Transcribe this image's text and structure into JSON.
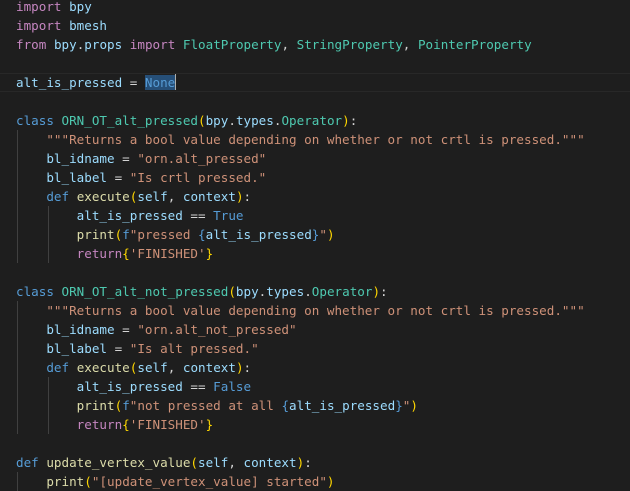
{
  "editor": {
    "language": "python",
    "selection": "None",
    "lines": [
      [
        [
          "ctl",
          "import"
        ],
        [
          "op",
          " "
        ],
        [
          "var",
          "bpy"
        ]
      ],
      [
        [
          "ctl",
          "import"
        ],
        [
          "op",
          " "
        ],
        [
          "var",
          "bmesh"
        ]
      ],
      [
        [
          "ctl",
          "from"
        ],
        [
          "op",
          " "
        ],
        [
          "var",
          "bpy"
        ],
        [
          "op",
          "."
        ],
        [
          "var",
          "props"
        ],
        [
          "op",
          " "
        ],
        [
          "ctl",
          "import"
        ],
        [
          "op",
          " "
        ],
        [
          "cls",
          "FloatProperty"
        ],
        [
          "op",
          ", "
        ],
        [
          "cls",
          "StringProperty"
        ],
        [
          "op",
          ", "
        ],
        [
          "cls",
          "PointerProperty"
        ]
      ],
      [],
      [
        [
          "var",
          "alt_is_pressed"
        ],
        [
          "op",
          " = "
        ],
        [
          "sel",
          "None"
        ]
      ],
      [],
      [
        [
          "kw",
          "class"
        ],
        [
          "op",
          " "
        ],
        [
          "cls",
          "ORN_OT_alt_pressed"
        ],
        [
          "p1",
          "("
        ],
        [
          "var",
          "bpy"
        ],
        [
          "op",
          "."
        ],
        [
          "var",
          "types"
        ],
        [
          "op",
          "."
        ],
        [
          "cls",
          "Operator"
        ],
        [
          "p1",
          ")"
        ],
        [
          "op",
          ":"
        ]
      ],
      [
        [
          "op",
          "    "
        ],
        [
          "str",
          "\"\"\"Returns a bool value depending on whether or not crtl is pressed.\"\"\""
        ]
      ],
      [
        [
          "op",
          "    "
        ],
        [
          "var",
          "bl_idname"
        ],
        [
          "op",
          " = "
        ],
        [
          "str",
          "\"orn.alt_pressed\""
        ]
      ],
      [
        [
          "op",
          "    "
        ],
        [
          "var",
          "bl_label"
        ],
        [
          "op",
          " = "
        ],
        [
          "str",
          "\"Is crtl pressed.\""
        ]
      ],
      [
        [
          "op",
          "    "
        ],
        [
          "kw",
          "def"
        ],
        [
          "op",
          " "
        ],
        [
          "fn",
          "execute"
        ],
        [
          "p1",
          "("
        ],
        [
          "var",
          "self"
        ],
        [
          "op",
          ", "
        ],
        [
          "var",
          "context"
        ],
        [
          "p1",
          ")"
        ],
        [
          "op",
          ":"
        ]
      ],
      [
        [
          "op",
          "        "
        ],
        [
          "var",
          "alt_is_pressed"
        ],
        [
          "op",
          " == "
        ],
        [
          "kw",
          "True"
        ]
      ],
      [
        [
          "op",
          "        "
        ],
        [
          "fn",
          "print"
        ],
        [
          "p1",
          "("
        ],
        [
          "kw",
          "f"
        ],
        [
          "str",
          "\"pressed "
        ],
        [
          "kw",
          "{"
        ],
        [
          "var",
          "alt_is_pressed"
        ],
        [
          "kw",
          "}"
        ],
        [
          "str",
          "\""
        ],
        [
          "p1",
          ")"
        ]
      ],
      [
        [
          "op",
          "        "
        ],
        [
          "ctl",
          "return"
        ],
        [
          "p1",
          "{"
        ],
        [
          "str",
          "'FINISHED'"
        ],
        [
          "p1",
          "}"
        ]
      ],
      [],
      [
        [
          "kw",
          "class"
        ],
        [
          "op",
          " "
        ],
        [
          "cls",
          "ORN_OT_alt_not_pressed"
        ],
        [
          "p1",
          "("
        ],
        [
          "var",
          "bpy"
        ],
        [
          "op",
          "."
        ],
        [
          "var",
          "types"
        ],
        [
          "op",
          "."
        ],
        [
          "cls",
          "Operator"
        ],
        [
          "p1",
          ")"
        ],
        [
          "op",
          ":"
        ]
      ],
      [
        [
          "op",
          "    "
        ],
        [
          "str",
          "\"\"\"Returns a bool value depending on whether or not crtl is pressed.\"\"\""
        ]
      ],
      [
        [
          "op",
          "    "
        ],
        [
          "var",
          "bl_idname"
        ],
        [
          "op",
          " = "
        ],
        [
          "str",
          "\"orn.alt_not_pressed\""
        ]
      ],
      [
        [
          "op",
          "    "
        ],
        [
          "var",
          "bl_label"
        ],
        [
          "op",
          " = "
        ],
        [
          "str",
          "\"Is alt pressed.\""
        ]
      ],
      [
        [
          "op",
          "    "
        ],
        [
          "kw",
          "def"
        ],
        [
          "op",
          " "
        ],
        [
          "fn",
          "execute"
        ],
        [
          "p1",
          "("
        ],
        [
          "var",
          "self"
        ],
        [
          "op",
          ", "
        ],
        [
          "var",
          "context"
        ],
        [
          "p1",
          ")"
        ],
        [
          "op",
          ":"
        ]
      ],
      [
        [
          "op",
          "        "
        ],
        [
          "var",
          "alt_is_pressed"
        ],
        [
          "op",
          " == "
        ],
        [
          "kw",
          "False"
        ]
      ],
      [
        [
          "op",
          "        "
        ],
        [
          "fn",
          "print"
        ],
        [
          "p1",
          "("
        ],
        [
          "kw",
          "f"
        ],
        [
          "str",
          "\"not pressed at all "
        ],
        [
          "kw",
          "{"
        ],
        [
          "var",
          "alt_is_pressed"
        ],
        [
          "kw",
          "}"
        ],
        [
          "str",
          "\""
        ],
        [
          "p1",
          ")"
        ]
      ],
      [
        [
          "op",
          "        "
        ],
        [
          "ctl",
          "return"
        ],
        [
          "p1",
          "{"
        ],
        [
          "str",
          "'FINISHED'"
        ],
        [
          "p1",
          "}"
        ]
      ],
      [],
      [
        [
          "kw",
          "def"
        ],
        [
          "op",
          " "
        ],
        [
          "fn",
          "update_vertex_value"
        ],
        [
          "p1",
          "("
        ],
        [
          "var",
          "self"
        ],
        [
          "op",
          ", "
        ],
        [
          "var",
          "context"
        ],
        [
          "p1",
          ")"
        ],
        [
          "op",
          ":"
        ]
      ],
      [
        [
          "op",
          "    "
        ],
        [
          "fn",
          "print"
        ],
        [
          "p1",
          "("
        ],
        [
          "str",
          "\"[update_vertex_value] started\""
        ],
        [
          "p1",
          ")"
        ]
      ]
    ]
  }
}
